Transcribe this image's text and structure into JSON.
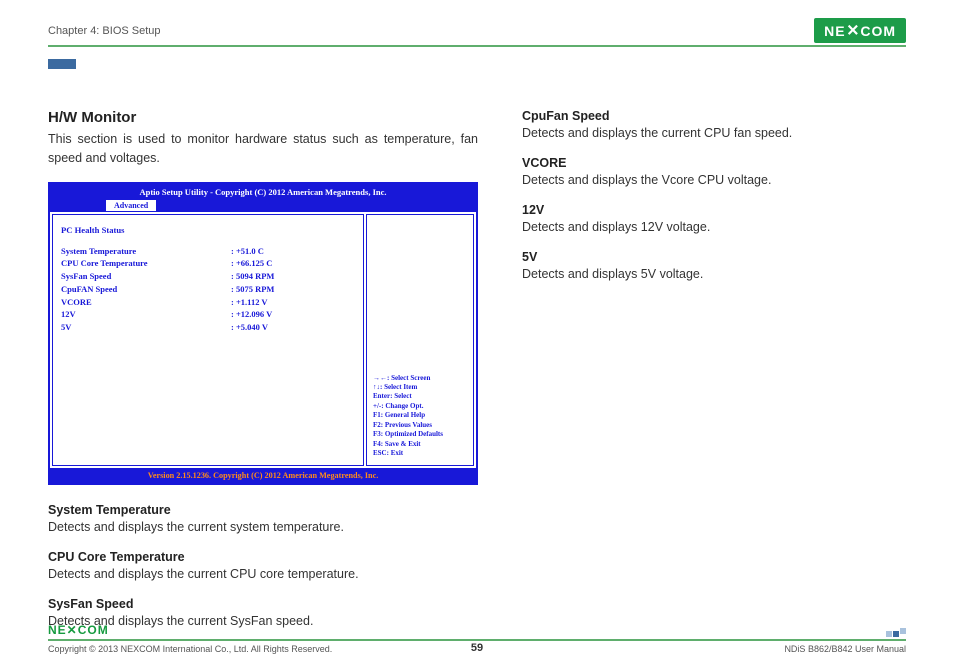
{
  "header": {
    "chapter": "Chapter 4: BIOS Setup",
    "brand": "NE✕COM"
  },
  "section": {
    "title": "H/W Monitor",
    "desc": "This section is used to monitor hardware status such as temperature, fan speed and voltages."
  },
  "bios": {
    "title": "Aptio Setup Utility - Copyright (C) 2012 American Megatrends, Inc.",
    "tab": "Advanced",
    "heading": "PC Health Status",
    "rows": [
      {
        "label": "System Temperature",
        "value": ": +51.0 C"
      },
      {
        "label": "CPU Core Temperature",
        "value": ": +66.125 C"
      },
      {
        "label": "SysFan Speed",
        "value": ": 5094 RPM"
      },
      {
        "label": "CpuFAN Speed",
        "value": ": 5075 RPM"
      },
      {
        "label": "VCORE",
        "value": ": +1.112 V"
      },
      {
        "label": "12V",
        "value": ": +12.096 V"
      },
      {
        "label": "5V",
        "value": ": +5.040 V"
      }
    ],
    "help": [
      "→←: Select Screen",
      "↑↓: Select Item",
      "Enter: Select",
      "+/-: Change Opt.",
      "F1: General Help",
      "F2: Previous Values",
      "F3: Optimized Defaults",
      "F4: Save & Exit",
      "ESC: Exit"
    ],
    "footer": "Version 2.15.1236. Copyright (C) 2012 American Megatrends, Inc."
  },
  "left_items": [
    {
      "title": "System Temperature",
      "desc": "Detects and displays the current system temperature."
    },
    {
      "title": "CPU Core Temperature",
      "desc": "Detects and displays the current CPU core temperature."
    },
    {
      "title": "SysFan Speed",
      "desc": "Detects and displays the current SysFan speed."
    }
  ],
  "right_items": [
    {
      "title": "CpuFan Speed",
      "desc": "Detects and displays the current CPU fan speed."
    },
    {
      "title": "VCORE",
      "desc": "Detects and displays the Vcore CPU voltage."
    },
    {
      "title": "12V",
      "desc": "Detects and displays 12V voltage."
    },
    {
      "title": "5V",
      "desc": "Detects and displays 5V voltage."
    }
  ],
  "footer": {
    "brand": "NE✕COM",
    "copyright": "Copyright © 2013 NEXCOM International Co., Ltd. All Rights Reserved.",
    "page": "59",
    "manual": "NDiS B862/B842 User Manual"
  }
}
